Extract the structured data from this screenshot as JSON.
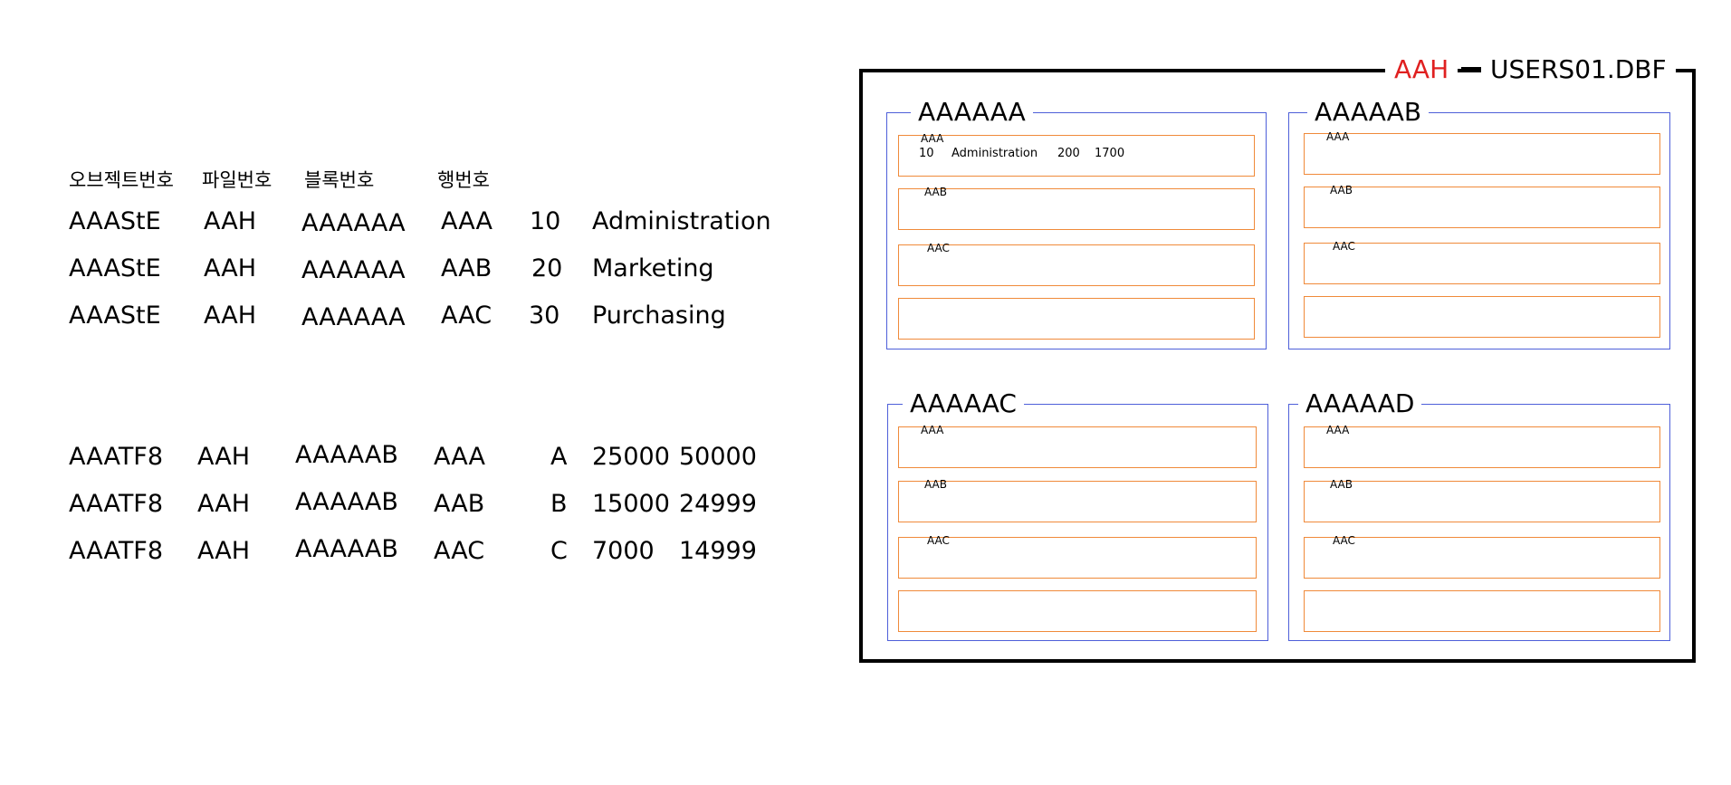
{
  "header_labels": {
    "object_no": "오브젝트번호",
    "file_no": "파일번호",
    "block_no": "블록번호",
    "row_no": "행번호"
  },
  "dept_rows": [
    {
      "object": "AAAStE",
      "file": "AAH",
      "block": "AAAAAA",
      "row": "AAA",
      "deptno": "10",
      "dname": "Administration"
    },
    {
      "object": "AAAStE",
      "file": "AAH",
      "block": "AAAAAA",
      "row": "AAB",
      "deptno": "20",
      "dname": "Marketing"
    },
    {
      "object": "AAAStE",
      "file": "AAH",
      "block": "AAAAAA",
      "row": "AAC",
      "deptno": "30",
      "dname": "Purchasing"
    }
  ],
  "grade_rows": [
    {
      "object": "AAATF8",
      "file": "AAH",
      "block": "AAAAAB",
      "row": "AAA",
      "grade": "A",
      "low": "25000",
      "high": "50000"
    },
    {
      "object": "AAATF8",
      "file": "AAH",
      "block": "AAAAAB",
      "row": "AAB",
      "grade": "B",
      "low": "15000",
      "high": "24999"
    },
    {
      "object": "AAATF8",
      "file": "AAH",
      "block": "AAAAAB",
      "row": "AAC",
      "grade": "C",
      "low": "7000",
      "high": "14999"
    }
  ],
  "datafile": {
    "file_id": "AAH",
    "file_name": "USERS01.DBF",
    "file_id_color": "#e02020",
    "block_border_color": "#4e5fd9",
    "row_border_color": "#f08a3a",
    "blocks": [
      {
        "label": "AAAAAA",
        "rows": [
          "AAA",
          "AAB",
          "AAC",
          ""
        ],
        "first_row_data": [
          "10",
          "Administration",
          "200",
          "1700"
        ]
      },
      {
        "label": "AAAAAB",
        "rows": [
          "AAA",
          "AAB",
          "AAC",
          ""
        ]
      },
      {
        "label": "AAAAAC",
        "rows": [
          "AAA",
          "AAB",
          "AAC",
          ""
        ]
      },
      {
        "label": "AAAAAD",
        "rows": [
          "AAA",
          "AAB",
          "AAC",
          ""
        ]
      }
    ]
  }
}
